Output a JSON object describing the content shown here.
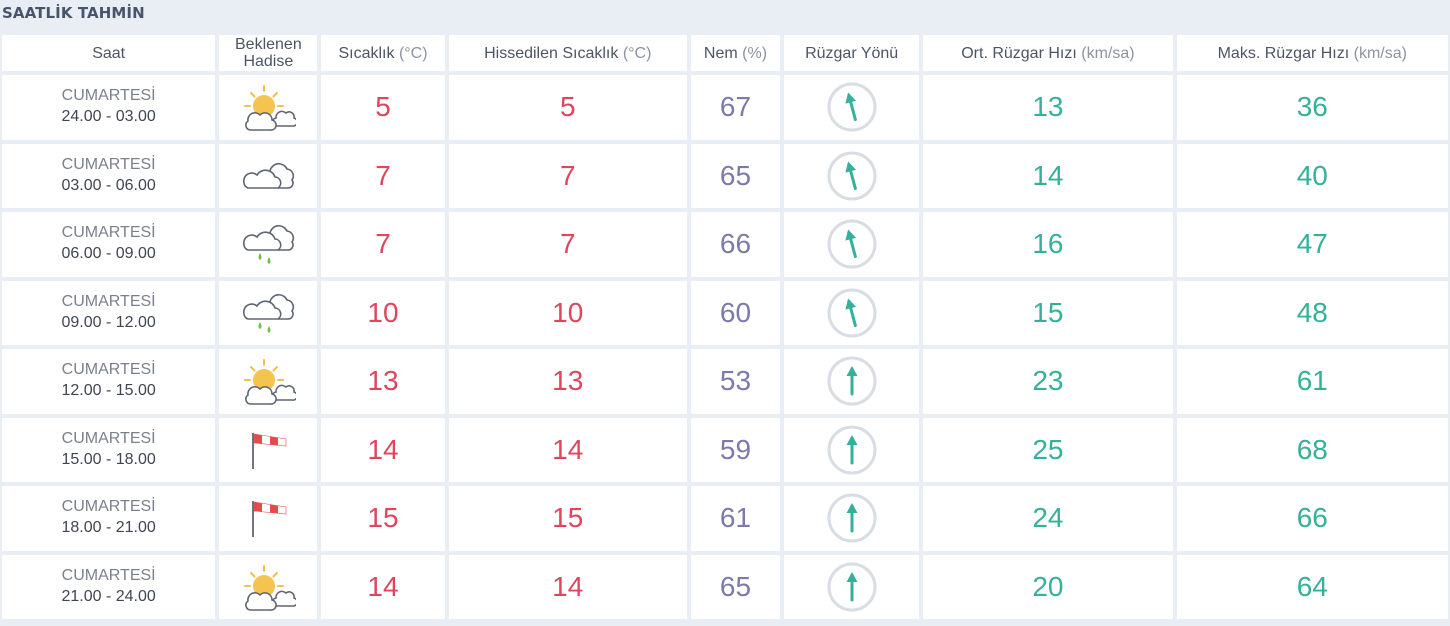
{
  "title": "SAATLİK TAHMİN",
  "headers": {
    "time": "Saat",
    "event_line1": "Beklenen",
    "event_line2": "Hadise",
    "temp": "Sıcaklık",
    "temp_unit": "(°C)",
    "feel": "Hissedilen Sıcaklık",
    "feel_unit": "(°C)",
    "humidity": "Nem",
    "humidity_unit": "(%)",
    "wind_dir": "Rüzgar Yönü",
    "wind_avg": "Ort. Rüzgar Hızı",
    "wind_avg_unit": "(km/sa)",
    "wind_max": "Maks. Rüzgar Hızı",
    "wind_max_unit": "(km/sa)"
  },
  "colors": {
    "temperature": "#e0455d",
    "humidity": "#7d79ad",
    "wind": "#34b19a"
  },
  "rows": [
    {
      "day": "CUMARTESİ",
      "range": "24.00 - 03.00",
      "icon": "partly-cloudy-icon",
      "temp": "5",
      "feel": "5",
      "humidity": "67",
      "wind_dir_deg": -15,
      "wind_avg": "13",
      "wind_max": "36"
    },
    {
      "day": "CUMARTESİ",
      "range": "03.00 - 06.00",
      "icon": "cloudy-icon",
      "temp": "7",
      "feel": "7",
      "humidity": "65",
      "wind_dir_deg": -15,
      "wind_avg": "14",
      "wind_max": "40"
    },
    {
      "day": "CUMARTESİ",
      "range": "06.00 - 09.00",
      "icon": "rain-cloud-icon",
      "temp": "7",
      "feel": "7",
      "humidity": "66",
      "wind_dir_deg": -15,
      "wind_avg": "16",
      "wind_max": "47"
    },
    {
      "day": "CUMARTESİ",
      "range": "09.00 - 12.00",
      "icon": "rain-cloud-icon",
      "temp": "10",
      "feel": "10",
      "humidity": "60",
      "wind_dir_deg": -15,
      "wind_avg": "15",
      "wind_max": "48"
    },
    {
      "day": "CUMARTESİ",
      "range": "12.00 - 15.00",
      "icon": "partly-cloudy-icon",
      "temp": "13",
      "feel": "13",
      "humidity": "53",
      "wind_dir_deg": 0,
      "wind_avg": "23",
      "wind_max": "61"
    },
    {
      "day": "CUMARTESİ",
      "range": "15.00 - 18.00",
      "icon": "windsock-icon",
      "temp": "14",
      "feel": "14",
      "humidity": "59",
      "wind_dir_deg": 0,
      "wind_avg": "25",
      "wind_max": "68"
    },
    {
      "day": "CUMARTESİ",
      "range": "18.00 - 21.00",
      "icon": "windsock-icon",
      "temp": "15",
      "feel": "15",
      "humidity": "61",
      "wind_dir_deg": 0,
      "wind_avg": "24",
      "wind_max": "66"
    },
    {
      "day": "CUMARTESİ",
      "range": "21.00 - 24.00",
      "icon": "partly-cloudy-icon",
      "temp": "14",
      "feel": "14",
      "humidity": "65",
      "wind_dir_deg": 0,
      "wind_avg": "20",
      "wind_max": "64"
    }
  ]
}
